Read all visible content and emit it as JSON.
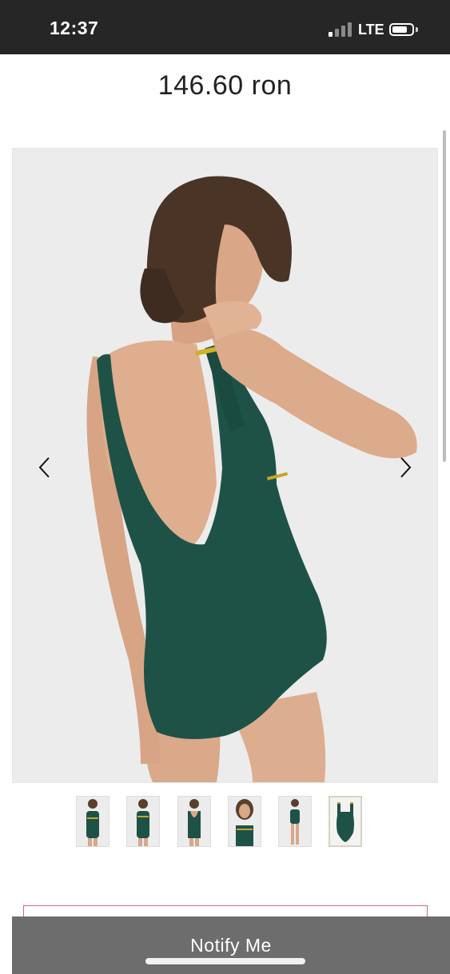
{
  "status_bar": {
    "time": "12:37",
    "network": "LTE",
    "signal_bars_active": 1,
    "signal_bars_total": 4,
    "battery_level": 0.8
  },
  "product": {
    "price": "146.60 ron",
    "image_description_icon": "swimsuit-photo",
    "current_image_index": 0,
    "thumbnail_count": 6,
    "selected_thumbnail_index": 5
  },
  "gallery": {
    "prev_icon": "chevron-left-icon",
    "next_icon": "chevron-right-icon"
  },
  "actions": {
    "notify_label": "Notify Me"
  },
  "colors": {
    "swimsuit": "#1f5247",
    "status_bar": "#262626",
    "button": "#6d6d6d",
    "outline_accent": "#c36a96"
  }
}
